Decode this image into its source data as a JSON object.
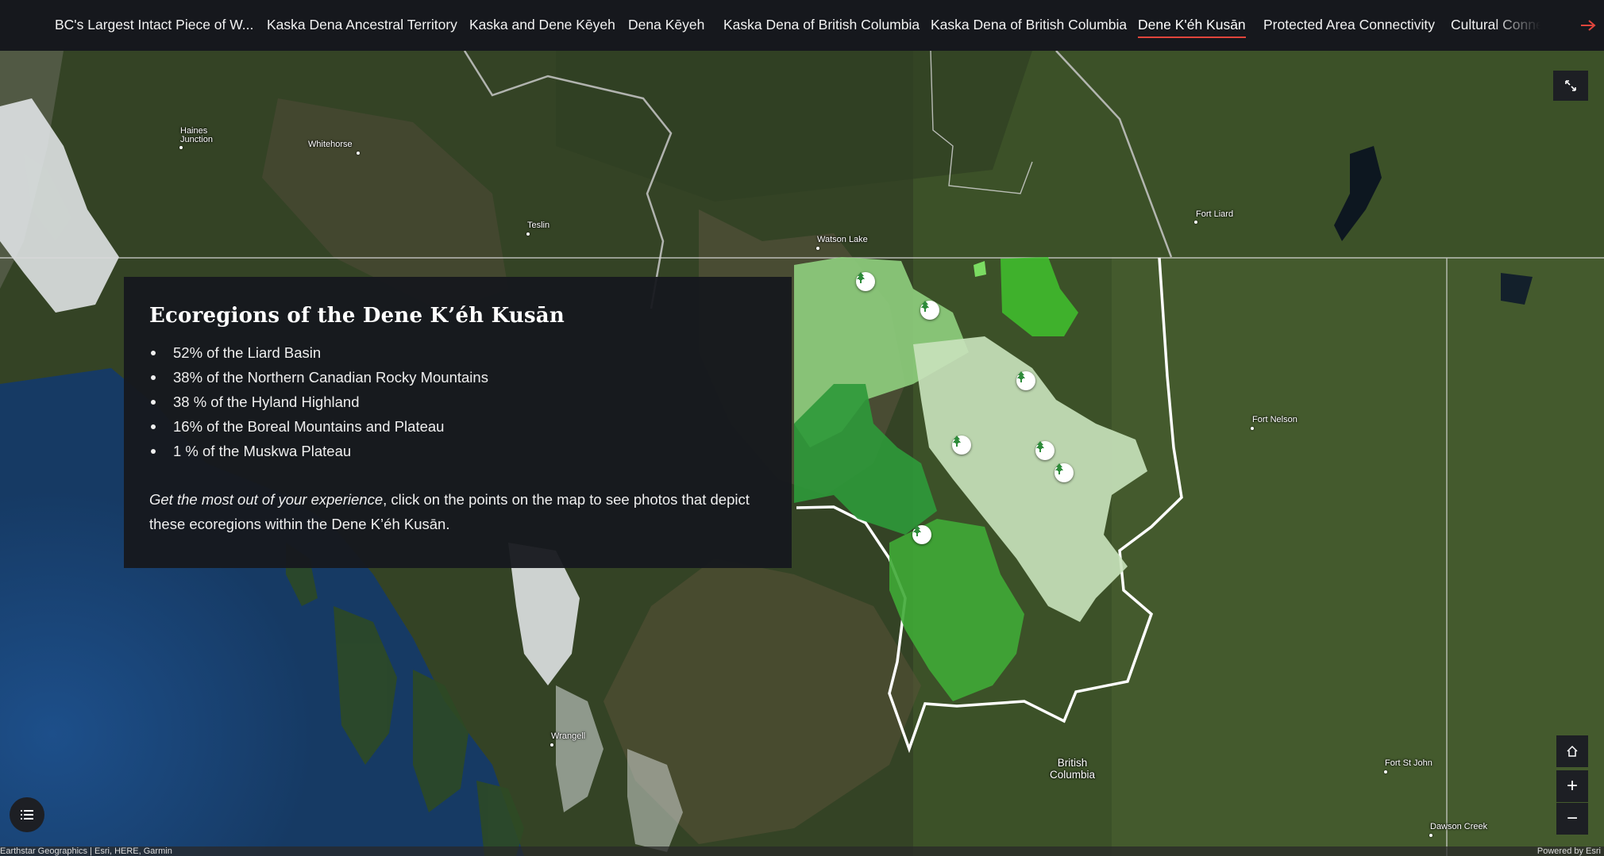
{
  "nav": {
    "tabs": [
      {
        "label": "BC's Largest Intact Piece of W..."
      },
      {
        "label": "Kaska Dena Ancestral Territory"
      },
      {
        "label": "Kaska and Dene Kēyeh"
      },
      {
        "label": "Dena Kēyeh"
      },
      {
        "label": "Kaska Dena of British Columbia"
      },
      {
        "label": "Kaska Dena of British Columbia"
      },
      {
        "label": "Dene K'éh Kusān"
      },
      {
        "label": "Protected Area Connectivity"
      },
      {
        "label": "Cultural Conne"
      }
    ],
    "active_index": 6,
    "next_icon": "arrow-right-icon",
    "accent_color": "#e0453c"
  },
  "map": {
    "places": [
      {
        "name": "Haines\nJunction"
      },
      {
        "name": "Whitehorse"
      },
      {
        "name": "Teslin"
      },
      {
        "name": "Watson Lake"
      },
      {
        "name": "Fort Liard"
      },
      {
        "name": "Fort Nelson"
      },
      {
        "name": "Wrangell"
      },
      {
        "name": "British\nColumbia"
      },
      {
        "name": "Fort St John"
      },
      {
        "name": "Dawson Creek"
      }
    ],
    "marker_icon": "tree-icon",
    "ecoregion_colors": [
      "#8fcf7e",
      "#c9e3bd",
      "#2e9a3a",
      "#3faa36",
      "#5cc248"
    ]
  },
  "panel": {
    "title": "Ecoregions of the Dene K’éh Kusān",
    "items": [
      "52% of the Liard Basin",
      "38% of the Northern Canadian Rocky Mountains",
      "38 % of the Hyland Highland",
      "16% of the Boreal Mountains and Plateau",
      "1 % of the Muskwa Plateau"
    ],
    "note_italic": "Get the most out of your experience",
    "note_rest": ", click on the points on the map to see photos that depict these ecoregions within the Dene K’éh Kusān."
  },
  "controls": {
    "expand_icon": "expand-icon",
    "home_icon": "home-icon",
    "zoom_in_label": "+",
    "zoom_out_label": "−",
    "legend_icon": "list-icon"
  },
  "footer": {
    "attribution": "Earthstar Geographics | Esri, HERE, Garmin",
    "powered_by": "Powered by Esri"
  }
}
